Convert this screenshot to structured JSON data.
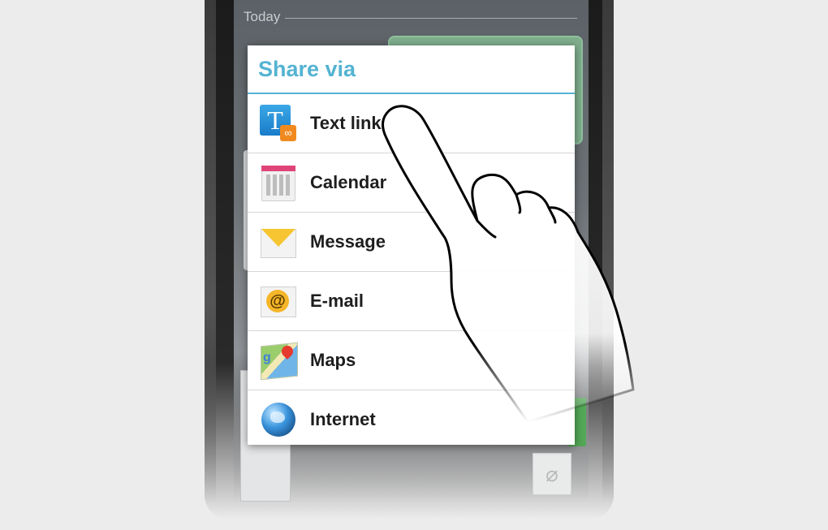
{
  "conversation": {
    "date_separator": "Today"
  },
  "dialog": {
    "title": "Share via",
    "options": [
      {
        "label": "Text link",
        "icon": "text-link-icon"
      },
      {
        "label": "Calendar",
        "icon": "calendar-icon"
      },
      {
        "label": "Message",
        "icon": "message-icon"
      },
      {
        "label": "E-mail",
        "icon": "email-icon"
      },
      {
        "label": "Maps",
        "icon": "maps-icon"
      },
      {
        "label": "Internet",
        "icon": "internet-icon"
      }
    ]
  },
  "colors": {
    "accent": "#54b3d2",
    "background": "#ececec"
  }
}
